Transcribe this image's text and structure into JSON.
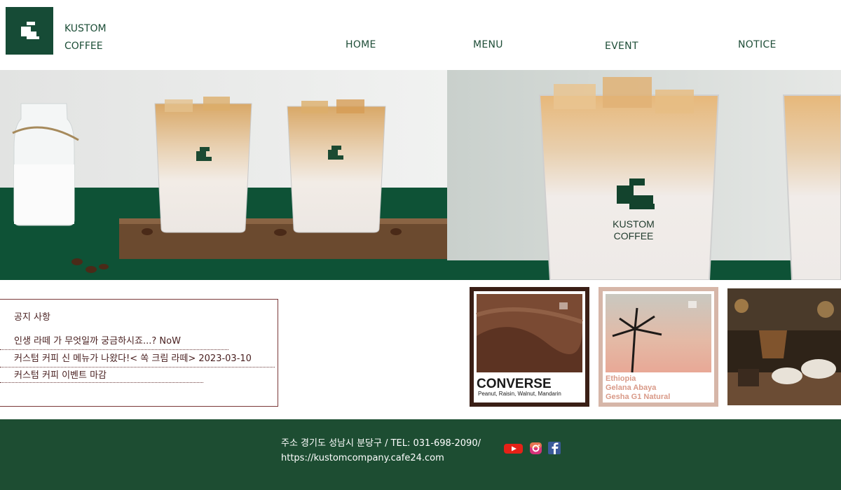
{
  "brand": {
    "line1": "KUSTOM",
    "line2": "COFFEE"
  },
  "nav": [
    {
      "label": "HOME"
    },
    {
      "label": "MENU"
    },
    {
      "label": "EVENT"
    },
    {
      "label": "NOTICE"
    }
  ],
  "hero": {
    "cup_brand_line1": "KUSTOM",
    "cup_brand_line2": "COFFEE"
  },
  "notice": {
    "title": "공지 사항",
    "items": [
      {
        "text": "인생 라떼 가 무엇일까 궁금하시죠...?   NoW"
      },
      {
        "text": "커스텀 커피 신 메뉴가 나왔다!< 쏙 크림 라떼>  2023-03-10"
      },
      {
        "text": "커스텀 커피  이벤트    마감"
      }
    ]
  },
  "thumbs": {
    "converse": {
      "title": "CONVERSE",
      "notes": "Peanut, Raisin, Walnut, Mandarin"
    },
    "ethiopia": {
      "line1": "Ethiopia",
      "line2": "Gelana Abaya",
      "line3": "Gesha G1 Natural"
    }
  },
  "footer": {
    "address": "주소 경기도 성남시 분당구   / TEL: 031-698-2090/",
    "url": "https://kustomcompany.cafe24.com"
  },
  "social": [
    "youtube-icon",
    "instagram-icon",
    "facebook-icon"
  ],
  "colors": {
    "brand_green": "#164b36",
    "notice_border": "#7a3838",
    "footer_bg": "#1d4d32"
  }
}
